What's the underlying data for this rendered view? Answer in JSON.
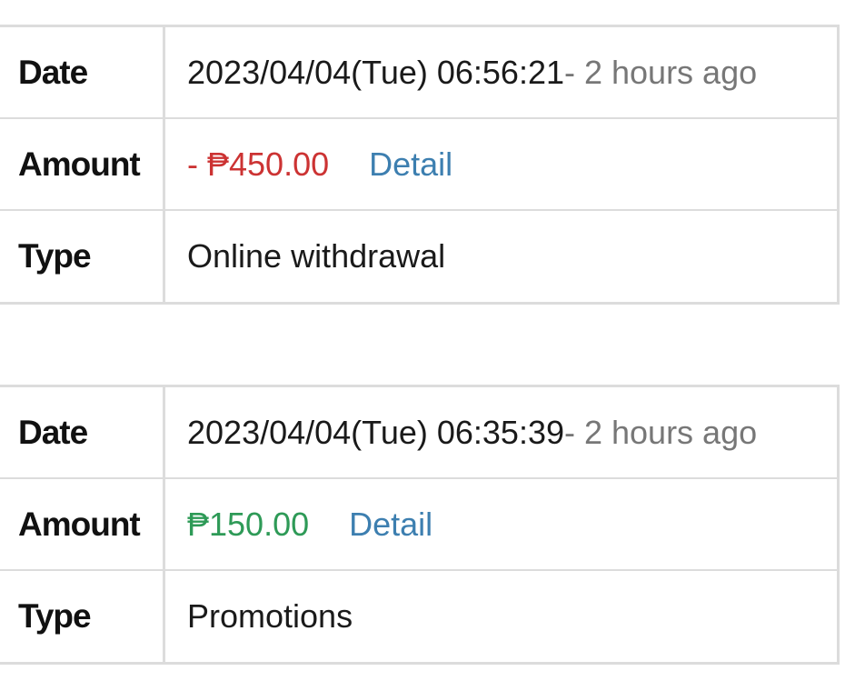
{
  "records": [
    {
      "date_label": "Date",
      "date_value": "2023/04/04(Tue) 06:56:21",
      "date_ago": "- 2 hours ago",
      "amount_label": "Amount",
      "amount_value": "- ₱450.00",
      "amount_color": "#cc3333",
      "detail_label": "Detail",
      "type_label": "Type",
      "type_value": "Online withdrawal"
    },
    {
      "date_label": "Date",
      "date_value": "2023/04/04(Tue) 06:35:39",
      "date_ago": "- 2 hours ago",
      "amount_label": "Amount",
      "amount_value": "₱150.00",
      "amount_color": "#2e9a57",
      "detail_label": "Detail",
      "type_label": "Type",
      "type_value": "Promotions"
    }
  ]
}
